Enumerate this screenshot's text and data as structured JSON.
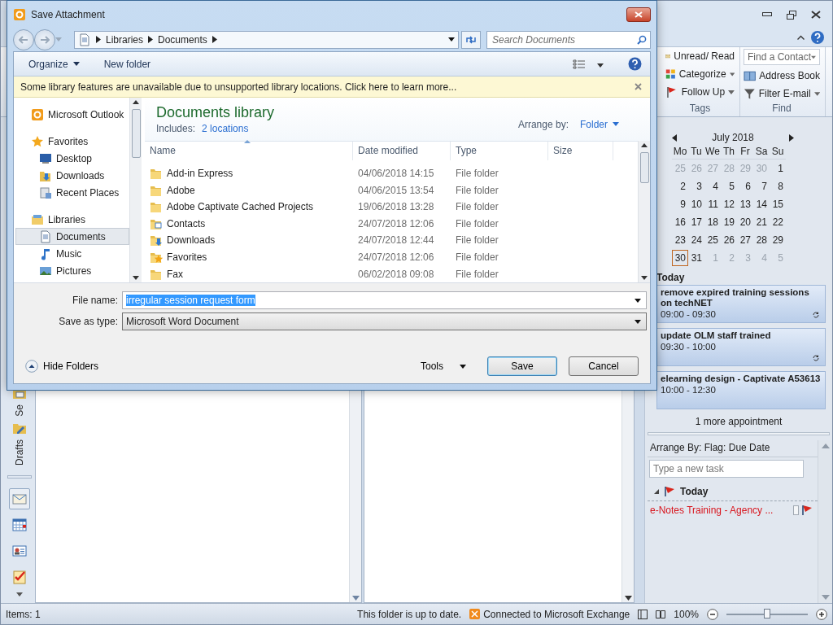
{
  "outlook": {
    "ribbon": {
      "groups": [
        {
          "label": "Tags",
          "items": [
            {
              "kind": "envelope",
              "label": "Unread/ Read",
              "dropdown": false
            },
            {
              "kind": "categories",
              "label": "Categorize",
              "dropdown": true
            },
            {
              "kind": "flag",
              "label": "Follow Up",
              "dropdown": true
            }
          ]
        },
        {
          "label": "Find",
          "items": [
            {
              "kind": "field",
              "label": "Find a Contact",
              "dropdown": true
            },
            {
              "kind": "book",
              "label": "Address Book",
              "dropdown": false
            },
            {
              "kind": "filter",
              "label": "Filter E-mail",
              "dropdown": true
            }
          ]
        }
      ]
    },
    "nav": {
      "folder_labels": [
        "Se",
        "Drafts"
      ],
      "modules": [
        {
          "kind": "mail",
          "selected": true
        },
        {
          "kind": "calendar",
          "selected": false
        },
        {
          "kind": "contacts",
          "selected": false
        },
        {
          "kind": "tasks",
          "selected": false
        }
      ]
    },
    "calendar": {
      "month": "July 2018",
      "weekdays": [
        "Mo",
        "Tu",
        "We",
        "Th",
        "Fr",
        "Sa",
        "Su"
      ],
      "weeks": [
        [
          {
            "day": "25",
            "muted": true,
            "selected": false
          },
          {
            "day": "26",
            "muted": true,
            "selected": false
          },
          {
            "day": "27",
            "muted": true,
            "selected": false
          },
          {
            "day": "28",
            "muted": true,
            "selected": false
          },
          {
            "day": "29",
            "muted": true,
            "selected": false
          },
          {
            "day": "30",
            "muted": true,
            "selected": false
          },
          {
            "day": "1",
            "muted": false,
            "selected": false
          }
        ],
        [
          {
            "day": "2",
            "muted": false,
            "selected": false
          },
          {
            "day": "3",
            "muted": false,
            "selected": false
          },
          {
            "day": "4",
            "muted": false,
            "selected": false
          },
          {
            "day": "5",
            "muted": false,
            "selected": false
          },
          {
            "day": "6",
            "muted": false,
            "selected": false
          },
          {
            "day": "7",
            "muted": false,
            "selected": false
          },
          {
            "day": "8",
            "muted": false,
            "selected": false
          }
        ],
        [
          {
            "day": "9",
            "muted": false,
            "selected": false
          },
          {
            "day": "10",
            "muted": false,
            "selected": false
          },
          {
            "day": "11",
            "muted": false,
            "selected": false
          },
          {
            "day": "12",
            "muted": false,
            "selected": false
          },
          {
            "day": "13",
            "muted": false,
            "selected": false
          },
          {
            "day": "14",
            "muted": false,
            "selected": false
          },
          {
            "day": "15",
            "muted": false,
            "selected": false
          }
        ],
        [
          {
            "day": "16",
            "muted": false,
            "selected": false
          },
          {
            "day": "17",
            "muted": false,
            "selected": false
          },
          {
            "day": "18",
            "muted": false,
            "selected": false
          },
          {
            "day": "19",
            "muted": false,
            "selected": false
          },
          {
            "day": "20",
            "muted": false,
            "selected": false
          },
          {
            "day": "21",
            "muted": false,
            "selected": false
          },
          {
            "day": "22",
            "muted": false,
            "selected": false
          }
        ],
        [
          {
            "day": "23",
            "muted": false,
            "selected": false
          },
          {
            "day": "24",
            "muted": false,
            "selected": false
          },
          {
            "day": "25",
            "muted": false,
            "selected": false
          },
          {
            "day": "26",
            "muted": false,
            "selected": false
          },
          {
            "day": "27",
            "muted": false,
            "selected": false
          },
          {
            "day": "28",
            "muted": false,
            "selected": false
          },
          {
            "day": "29",
            "muted": false,
            "selected": false
          }
        ],
        [
          {
            "day": "30",
            "muted": false,
            "selected": true
          },
          {
            "day": "31",
            "muted": false,
            "selected": false
          },
          {
            "day": "1",
            "muted": true,
            "selected": false
          },
          {
            "day": "2",
            "muted": true,
            "selected": false
          },
          {
            "day": "3",
            "muted": true,
            "selected": false
          },
          {
            "day": "4",
            "muted": true,
            "selected": false
          },
          {
            "day": "5",
            "muted": true,
            "selected": false
          }
        ]
      ]
    },
    "appointments": {
      "heading": "Today",
      "items": [
        {
          "title": "remove expired training sessions on techNET",
          "time": "09:00 - 09:30",
          "recurring": true
        },
        {
          "title": "update OLM staff trained",
          "time": "09:30 - 10:00",
          "recurring": true
        },
        {
          "title": "elearning design - Captivate A53613",
          "time": "10:00 - 12:30",
          "recurring": false
        }
      ],
      "more": "1 more appointment"
    },
    "tasks": {
      "arrange": "Arrange By: Flag: Due Date",
      "placeholder": "Type a new task",
      "group": "Today",
      "items": [
        {
          "title": "e-Notes Training - Agency ...",
          "overdue": true
        }
      ]
    },
    "status_bar": {
      "items": "Items: 1",
      "sync": "This folder is up to date.",
      "connection": "Connected to Microsoft Exchange",
      "zoom": "100%",
      "level": 0.5
    }
  },
  "dialog": {
    "title": "Save Attachment",
    "breadcrumb": [
      "Libraries",
      "Documents"
    ],
    "search": {
      "placeholder": "Search Documents"
    },
    "toolbar": [
      "Organize",
      "New folder"
    ],
    "infobar": "Some library features are unavailable due to unsupported library locations. Click here to learn more...",
    "nav": [
      {
        "label": "Microsoft Outlook",
        "kind": "outlook",
        "selected": false
      },
      {
        "label": "Favorites",
        "kind": "star",
        "selected": false,
        "children": [
          {
            "label": "Desktop",
            "kind": "desktop",
            "selected": false
          },
          {
            "label": "Downloads",
            "kind": "downloads",
            "selected": false
          },
          {
            "label": "Recent Places",
            "kind": "recent",
            "selected": false
          }
        ]
      },
      {
        "label": "Libraries",
        "kind": "libraries",
        "selected": false,
        "children": [
          {
            "label": "Documents",
            "kind": "document",
            "selected": true
          },
          {
            "label": "Music",
            "kind": "music",
            "selected": false
          },
          {
            "label": "Pictures",
            "kind": "pictures",
            "selected": false
          }
        ]
      }
    ],
    "library": {
      "title": "Documents library",
      "includes_label": "Includes:",
      "includes_link": "2 locations",
      "arrange_label": "Arrange by:",
      "arrange_value": "Folder"
    },
    "columns": [
      "Name",
      "Date modified",
      "Type",
      "Size"
    ],
    "rows": [
      {
        "name": "Add-in Express",
        "modified": "04/06/2018 14:15",
        "type": "File folder",
        "kind": "folder"
      },
      {
        "name": "Adobe",
        "modified": "04/06/2015 13:54",
        "type": "File folder",
        "kind": "folder"
      },
      {
        "name": "Adobe Captivate Cached Projects",
        "modified": "19/06/2018 13:28",
        "type": "File folder",
        "kind": "folder"
      },
      {
        "name": "Contacts",
        "modified": "24/07/2018 12:06",
        "type": "File folder",
        "kind": "contacts"
      },
      {
        "name": "Downloads",
        "modified": "24/07/2018 12:44",
        "type": "File folder",
        "kind": "downloads"
      },
      {
        "name": "Favorites",
        "modified": "24/07/2018 12:06",
        "type": "File folder",
        "kind": "favorites"
      },
      {
        "name": "Fax",
        "modified": "06/02/2018 09:08",
        "type": "File folder",
        "kind": "folder"
      }
    ],
    "file_name": {
      "label": "File name:",
      "value": "irregular session request form"
    },
    "save_type": {
      "label": "Save as type:",
      "value": "Microsoft Word Document"
    },
    "hide_folders": "Hide Folders",
    "tools": "Tools",
    "buttons": [
      "Save",
      "Cancel"
    ]
  }
}
